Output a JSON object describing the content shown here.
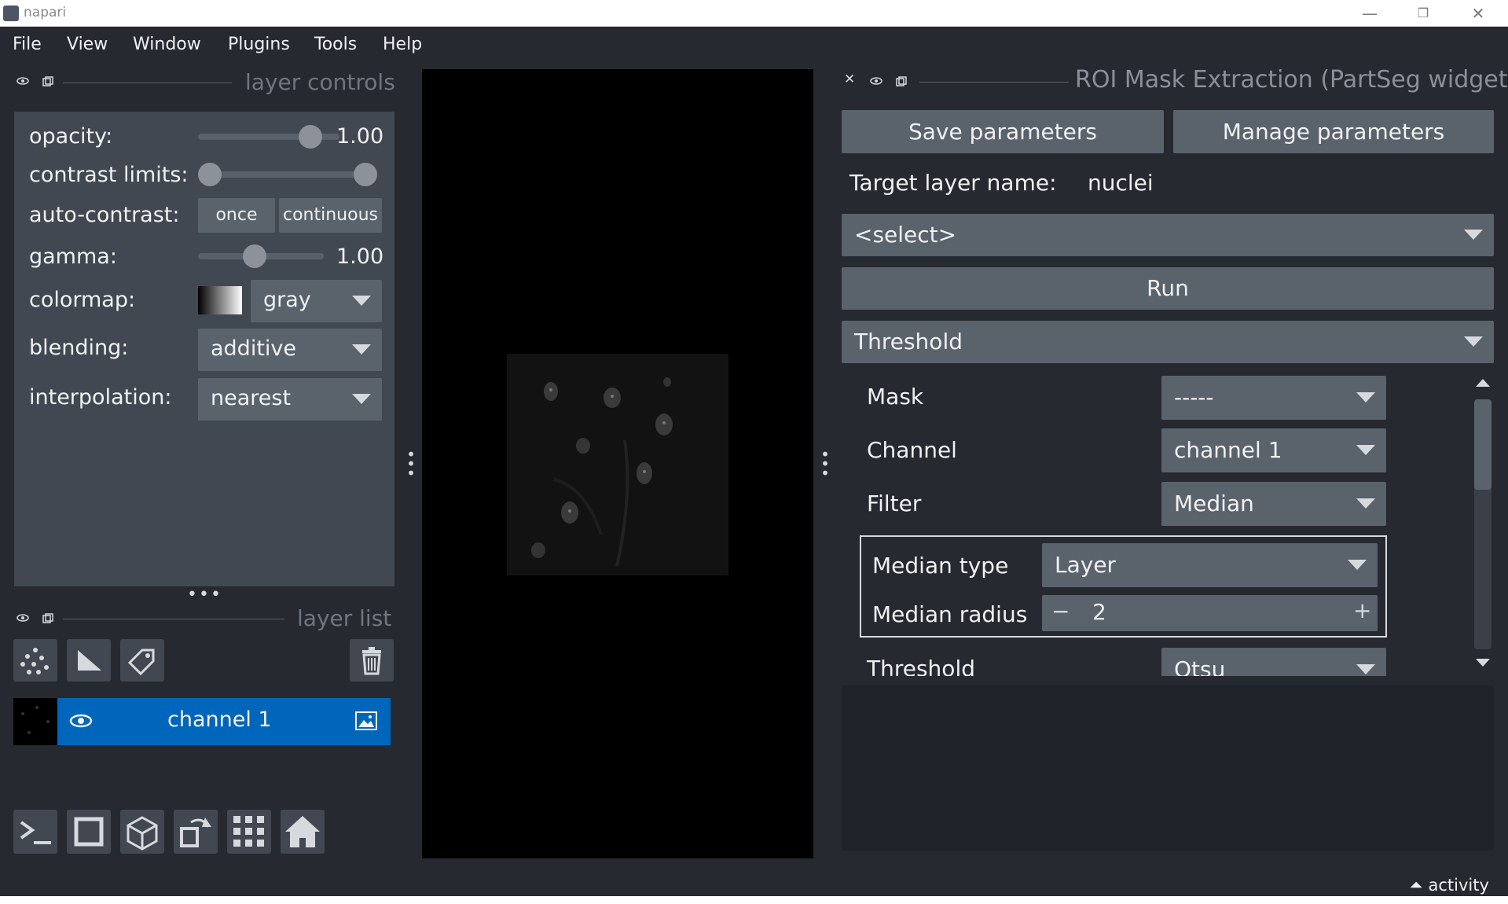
{
  "window": {
    "title": "napari",
    "minimize": "—",
    "restore": "❐",
    "close": "✕"
  },
  "menu": [
    "File",
    "View",
    "Window",
    "Plugins",
    "Tools",
    "Help"
  ],
  "layer_controls": {
    "header": "layer controls",
    "opacity_label": "opacity:",
    "opacity_value": "1.00",
    "opacity_level": 1.0,
    "contrast_label": "contrast limits:",
    "contrast_range": [
      0.0,
      1.0
    ],
    "autocontrast_label": "auto-contrast:",
    "once_label": "once",
    "continuous_label": "continuous",
    "gamma_label": "gamma:",
    "gamma_value": "1.00",
    "colormap_label": "colormap:",
    "colormap_value": "gray",
    "blending_label": "blending:",
    "blending_value": "additive",
    "interpolation_label": "interpolation:",
    "interpolation_value": "nearest"
  },
  "layer_list": {
    "header": "layer list",
    "layers": [
      {
        "name": "channel 1",
        "visible": true,
        "selected": true
      }
    ]
  },
  "roi": {
    "header": "ROI Mask Extraction (PartSeg widgets)",
    "save_label": "Save parameters",
    "manage_label": "Manage parameters",
    "target_label": "Target layer name:",
    "target_value": "nuclei",
    "select_value": "<select>",
    "run_label": "Run",
    "algorithm": "Threshold",
    "mask_label": "Mask",
    "mask_value": "-----",
    "channel_label": "Channel",
    "channel_value": "channel 1",
    "filter_label": "Filter",
    "filter_value": "Median",
    "median_type_label": "Median type",
    "median_type_value": "Layer",
    "median_radius_label": "Median radius",
    "median_radius_value": "2",
    "threshold_label": "Threshold",
    "threshold_value": "Otsu"
  },
  "status": {
    "activity": "activity"
  },
  "colors": {
    "bg": "#262930",
    "panel": "#414851",
    "accent": "#0066bb",
    "button": "#5a626c"
  },
  "icons": [
    "hide-icon",
    "float-icon",
    "close-icon",
    "points-icon",
    "shapes-icon",
    "labels-icon",
    "delete-icon",
    "eye-icon",
    "image-icon",
    "console-icon",
    "ndisplay-icon",
    "3d-icon",
    "roll-icon",
    "grid-icon",
    "home-icon"
  ]
}
